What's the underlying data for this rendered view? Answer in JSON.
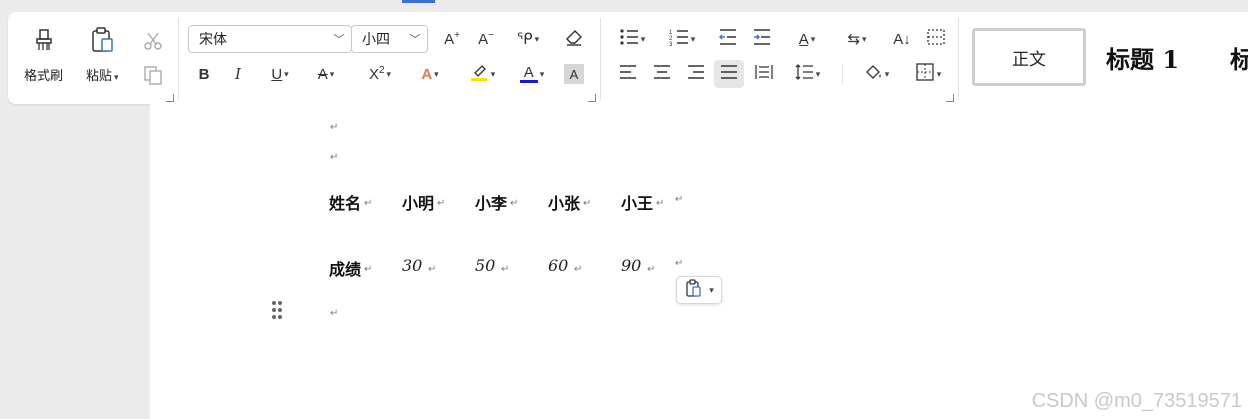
{
  "clipboard": {
    "format_painter_label": "格式刷",
    "paste_label": "粘贴"
  },
  "font": {
    "family": "宋体",
    "size": "小四"
  },
  "styles": {
    "normal": "正文",
    "heading1": "标题 1",
    "heading2": "标"
  },
  "document": {
    "header_row": [
      "姓名",
      "小明",
      "小李",
      "小张",
      "小王"
    ],
    "score_row": [
      "成绩",
      "30",
      "50",
      "60",
      "90"
    ],
    "paragraph_mark": "↵"
  },
  "watermark": "CSDN @m0_73519571",
  "colors": {
    "accent": "#3c6fd6",
    "highlight": "#f5e300",
    "font_color": "#1a1ad6",
    "ribbon_bg": "#ffffff",
    "app_bg": "#ebebeb"
  }
}
